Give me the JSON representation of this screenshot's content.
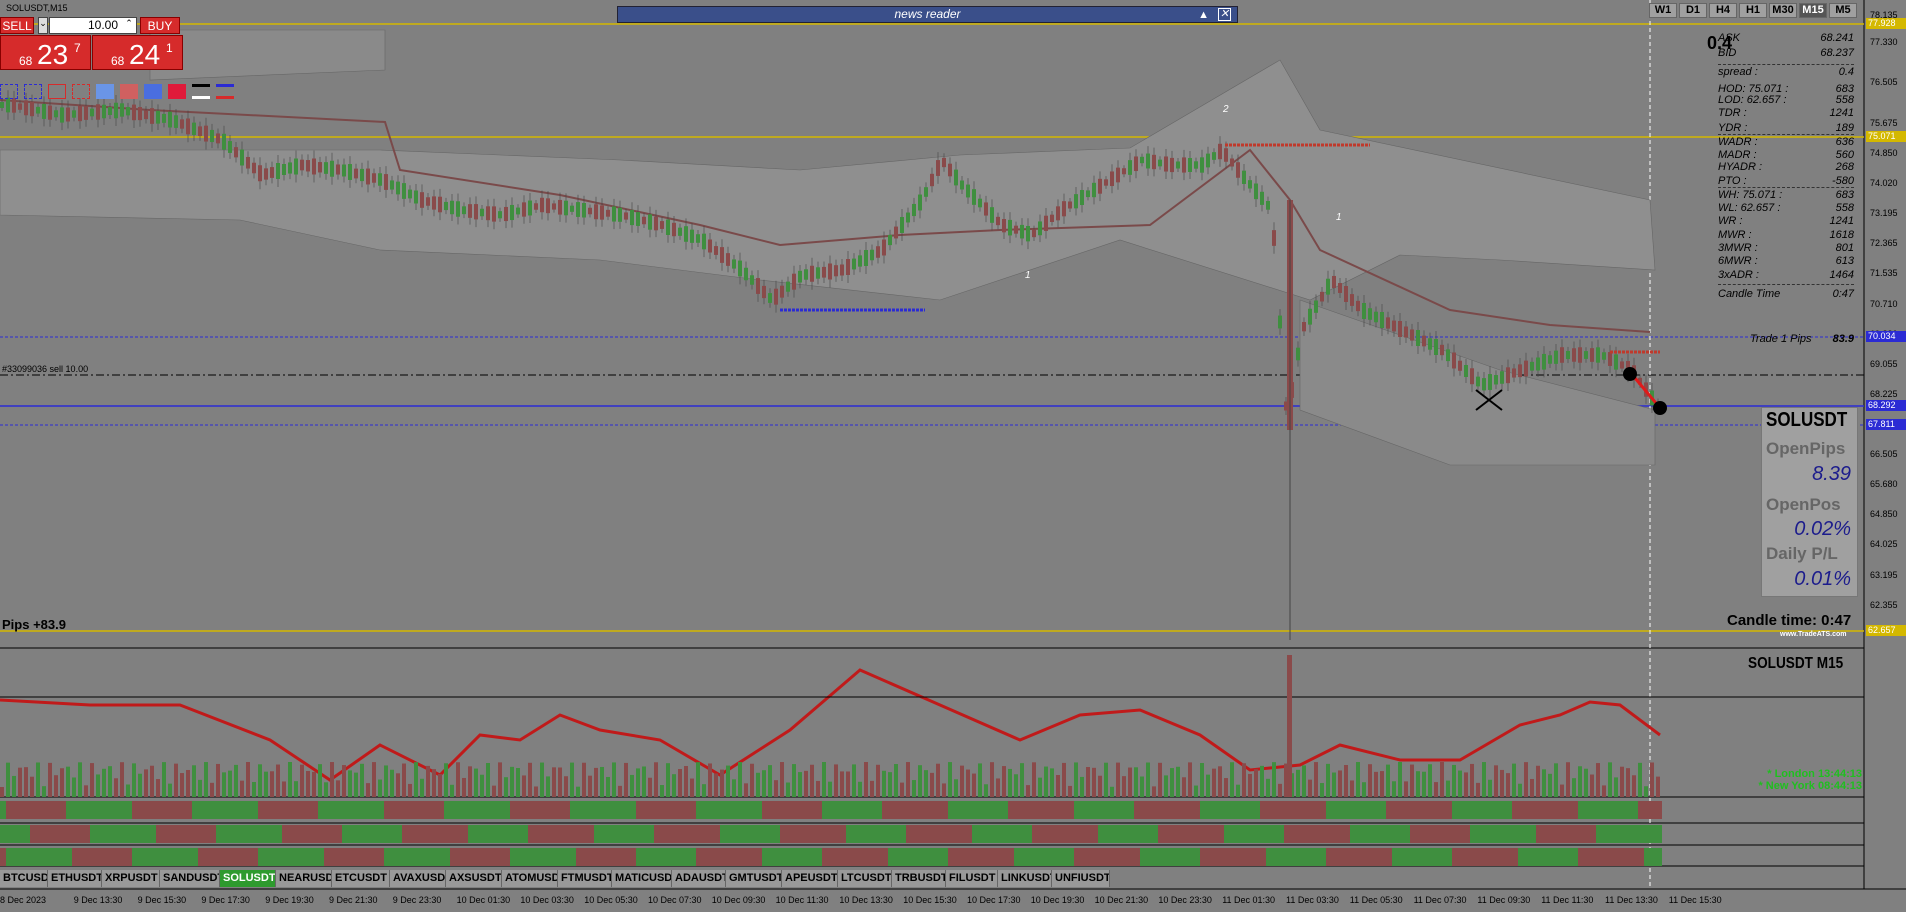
{
  "window": {
    "title": "SOLUSDT,M15"
  },
  "timeframes": [
    "W1",
    "D1",
    "H4",
    "H1",
    "M30",
    "M15",
    "M5"
  ],
  "active_timeframe": "M15",
  "news_reader": {
    "label": "news reader"
  },
  "trade_panel": {
    "sell_label": "SELL",
    "buy_label": "BUY",
    "lot_value": "10.00",
    "sell_price": {
      "prefix": "68",
      "big": "23",
      "sup": "7"
    },
    "buy_price": {
      "prefix": "68",
      "big": "24",
      "sup": "1"
    }
  },
  "spread_display": "0.4",
  "info_panel": [
    {
      "label": "ASK",
      "value": "68.241"
    },
    {
      "label": "BID",
      "value": "68.237"
    },
    {
      "label": "spread :",
      "value": "0.4"
    },
    {
      "label": "HOD:  75.071 :",
      "value": "683"
    },
    {
      "label": "LOD:  62.657 :",
      "value": "558"
    },
    {
      "label": "TDR :",
      "value": "1241"
    },
    {
      "label": "YDR :",
      "value": "189"
    },
    {
      "label": "WADR :",
      "value": "636"
    },
    {
      "label": "MADR :",
      "value": "560"
    },
    {
      "label": "HYADR :",
      "value": "268"
    },
    {
      "label": "PTO :",
      "value": "-580"
    },
    {
      "label": "WH:  75.071 :",
      "value": "683"
    },
    {
      "label": "WL:  62.657 :",
      "value": "558"
    },
    {
      "label": "WR :",
      "value": "1241"
    },
    {
      "label": "MWR :",
      "value": "1618"
    },
    {
      "label": "3MWR :",
      "value": "801"
    },
    {
      "label": "6MWR :",
      "value": "613"
    },
    {
      "label": "3xADR :",
      "value": "1464"
    },
    {
      "label": "Candle Time",
      "value": "0:47"
    }
  ],
  "trade_pips": {
    "label": "Trade 1 Pips",
    "value": "83.9"
  },
  "order_label": "#33099036 sell 10.00",
  "pips_total": "Pips +83.9",
  "pl_panel": {
    "symbol": "SOLUSDT",
    "open_pips_label": "OpenPips",
    "open_pips_value": "8.39",
    "open_pos_label": "OpenPos",
    "open_pos_value": "0.02%",
    "daily_pl_label": "Daily P/L",
    "daily_pl_value": "0.01%"
  },
  "candle_time": "Candle time:  0:47",
  "watermark": "www.TradeATS.com",
  "indicator_title": "SOLUSDT  M15",
  "clocks": [
    {
      "label": "* London   13:44:13"
    },
    {
      "label": "* New York   08:44:13"
    }
  ],
  "price_axis": [
    "78.135",
    "77.330",
    "76.505",
    "75.675",
    "74.850",
    "74.020",
    "73.195",
    "72.365",
    "71.535",
    "70.710",
    "69.880",
    "69.055",
    "68.225",
    "67.330",
    "66.505",
    "65.680",
    "64.850",
    "64.025",
    "63.195",
    "62.355"
  ],
  "price_tags": [
    {
      "text": "77.928",
      "color": "#d4b800"
    },
    {
      "text": "75.071",
      "color": "#d4b800"
    },
    {
      "text": "70.034",
      "color": "#2b2bd4"
    },
    {
      "text": "68.292",
      "color": "#2b2bd4"
    },
    {
      "text": "67.811",
      "color": "#2b2bd4"
    },
    {
      "text": "62.657",
      "color": "#d4b800"
    }
  ],
  "markers": [
    "2",
    "1",
    "1"
  ],
  "time_axis": [
    "8 Dec 2023",
    "9 Dec 13:30",
    "9 Dec 15:30",
    "9 Dec 17:30",
    "9 Dec 19:30",
    "9 Dec 21:30",
    "9 Dec 23:30",
    "10 Dec 01:30",
    "10 Dec 03:30",
    "10 Dec 05:30",
    "10 Dec 07:30",
    "10 Dec 09:30",
    "10 Dec 11:30",
    "10 Dec 13:30",
    "10 Dec 15:30",
    "10 Dec 17:30",
    "10 Dec 19:30",
    "10 Dec 21:30",
    "10 Dec 23:30",
    "11 Dec 01:30",
    "11 Dec 03:30",
    "11 Dec 05:30",
    "11 Dec 07:30",
    "11 Dec 09:30",
    "11 Dec 11:30",
    "11 Dec 13:30",
    "11 Dec 15:30"
  ],
  "symbol_tabs": [
    "BTCUSDT",
    "ETHUSDT",
    "XRPUSDT",
    "SANDUSDT",
    "SOLUSDT",
    "NEARUSDT",
    "ETCUSDT",
    "AVAXUSDT",
    "AXSUSDT",
    "ATOMUSDT",
    "FTMUSDT",
    "MATICUSDT",
    "ADAUSDT",
    "GMTUSDT",
    "APEUSDT",
    "LTCUSDT",
    "TRBUSDT",
    "FILUSDT",
    "LINKUSDT",
    "UNFIUSDT"
  ],
  "active_symbol": "SOLUSDT",
  "colors": {
    "bg": "#808080",
    "bull": "#3f8f3f",
    "bear": "#8a4a4a",
    "sell": "#d62b2b",
    "level_yellow": "#d4b800",
    "level_blue": "#2b2bd4"
  }
}
